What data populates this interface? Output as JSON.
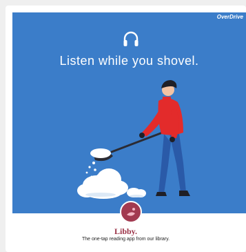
{
  "brand": {
    "name": "OverDrive"
  },
  "banner": {
    "headline": "Listen while you shovel.",
    "icon": "headphones-icon",
    "background_color": "#3b7dc9"
  },
  "app": {
    "name": "Libby.",
    "tagline": "The one-tap reading app from our library.",
    "logo_icon": "libby-logo-icon",
    "accent_color": "#9b3247"
  }
}
